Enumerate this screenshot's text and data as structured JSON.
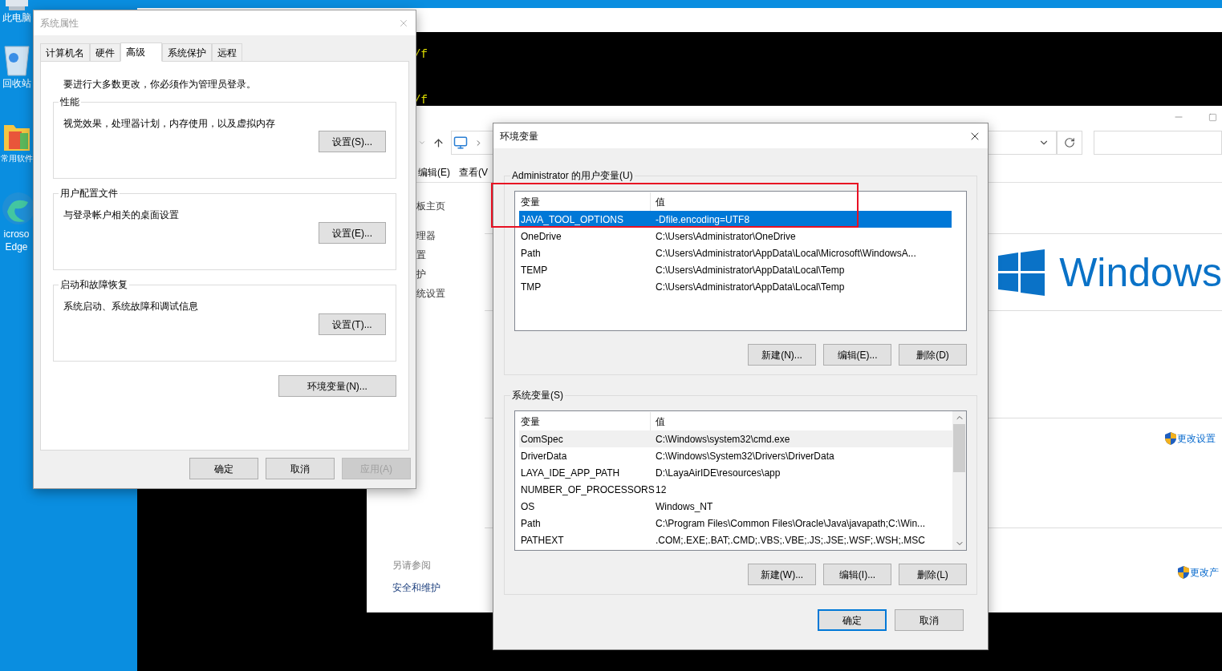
{
  "desktop_icons": [
    {
      "kind": "computer",
      "label_lines": [
        "此电脑"
      ]
    },
    {
      "kind": "recycle",
      "label_lines": [
        "回收站"
      ]
    },
    {
      "kind": "folder",
      "label_lines": [
        "常用软件"
      ]
    },
    {
      "kind": "edge",
      "label_lines": [
        "icroso",
        "Edge"
      ]
    }
  ],
  "console": {
    "lines": [
      "/f",
      "/f"
    ]
  },
  "control_panel": {
    "menu": [
      "编辑(E)",
      "查看(V"
    ],
    "sidebar": [
      "板主页",
      "理器",
      "置",
      "护",
      "统设置"
    ],
    "see_also": {
      "title": "另请参阅",
      "links": [
        "安全和维护"
      ]
    },
    "logo_text": "Windows",
    "links": [
      "更改设置",
      "更改产"
    ]
  },
  "system_properties": {
    "title": "系统属性",
    "tabs": [
      {
        "label": "计算机名",
        "selected": false
      },
      {
        "label": "硬件",
        "selected": false
      },
      {
        "label": "高级",
        "selected": true
      },
      {
        "label": "系统保护",
        "selected": false
      },
      {
        "label": "远程",
        "selected": false
      }
    ],
    "notice": "要进行大多数更改，你必须作为管理员登录。",
    "groups": [
      {
        "title": "性能",
        "description": "视觉效果，处理器计划，内存使用，以及虚拟内存",
        "button": "设置(S)..."
      },
      {
        "title": "用户配置文件",
        "description": "与登录帐户相关的桌面设置",
        "button": "设置(E)..."
      },
      {
        "title": "启动和故障恢复",
        "description": "系统启动、系统故障和调试信息",
        "button": "设置(T)..."
      }
    ],
    "env_button": "环境变量(N)...",
    "buttons": [
      {
        "label": "确定",
        "disabled": false
      },
      {
        "label": "取消",
        "disabled": false
      },
      {
        "label": "应用(A)",
        "disabled": true
      }
    ]
  },
  "env_dialog": {
    "title": "环境变量",
    "sections": [
      {
        "title": "Administrator 的用户变量(U)",
        "columns": [
          "变量",
          "值"
        ],
        "scrollbar": false,
        "rows": [
          {
            "name": "JAVA_TOOL_OPTIONS",
            "value": "-Dfile.encoding=UTF8",
            "selected": true,
            "highlighted": false
          },
          {
            "name": "OneDrive",
            "value": "C:\\Users\\Administrator\\OneDrive",
            "selected": false,
            "highlighted": false
          },
          {
            "name": "Path",
            "value": "C:\\Users\\Administrator\\AppData\\Local\\Microsoft\\WindowsA...",
            "selected": false,
            "highlighted": false
          },
          {
            "name": "TEMP",
            "value": "C:\\Users\\Administrator\\AppData\\Local\\Temp",
            "selected": false,
            "highlighted": false
          },
          {
            "name": "TMP",
            "value": "C:\\Users\\Administrator\\AppData\\Local\\Temp",
            "selected": false,
            "highlighted": false
          }
        ],
        "buttons": [
          "新建(N)...",
          "编辑(E)...",
          "删除(D)"
        ]
      },
      {
        "title": "系统变量(S)",
        "columns": [
          "变量",
          "值"
        ],
        "scrollbar": true,
        "rows": [
          {
            "name": "ComSpec",
            "value": "C:\\Windows\\system32\\cmd.exe",
            "selected": false,
            "highlighted": true
          },
          {
            "name": "DriverData",
            "value": "C:\\Windows\\System32\\Drivers\\DriverData",
            "selected": false,
            "highlighted": false
          },
          {
            "name": "LAYA_IDE_APP_PATH",
            "value": "D:\\LayaAirIDE\\resources\\app",
            "selected": false,
            "highlighted": false
          },
          {
            "name": "NUMBER_OF_PROCESSORS",
            "value": "12",
            "selected": false,
            "highlighted": false
          },
          {
            "name": "OS",
            "value": "Windows_NT",
            "selected": false,
            "highlighted": false
          },
          {
            "name": "Path",
            "value": "C:\\Program Files\\Common Files\\Oracle\\Java\\javapath;C:\\Win...",
            "selected": false,
            "highlighted": false
          },
          {
            "name": "PATHEXT",
            "value": ".COM;.EXE;.BAT;.CMD;.VBS;.VBE;.JS;.JSE;.WSF;.WSH;.MSC",
            "selected": false,
            "highlighted": false
          }
        ],
        "buttons": [
          "新建(W)...",
          "编辑(I)...",
          "删除(L)"
        ]
      }
    ],
    "footer_buttons": [
      {
        "label": "确定",
        "default": true
      },
      {
        "label": "取消",
        "default": false
      }
    ]
  }
}
